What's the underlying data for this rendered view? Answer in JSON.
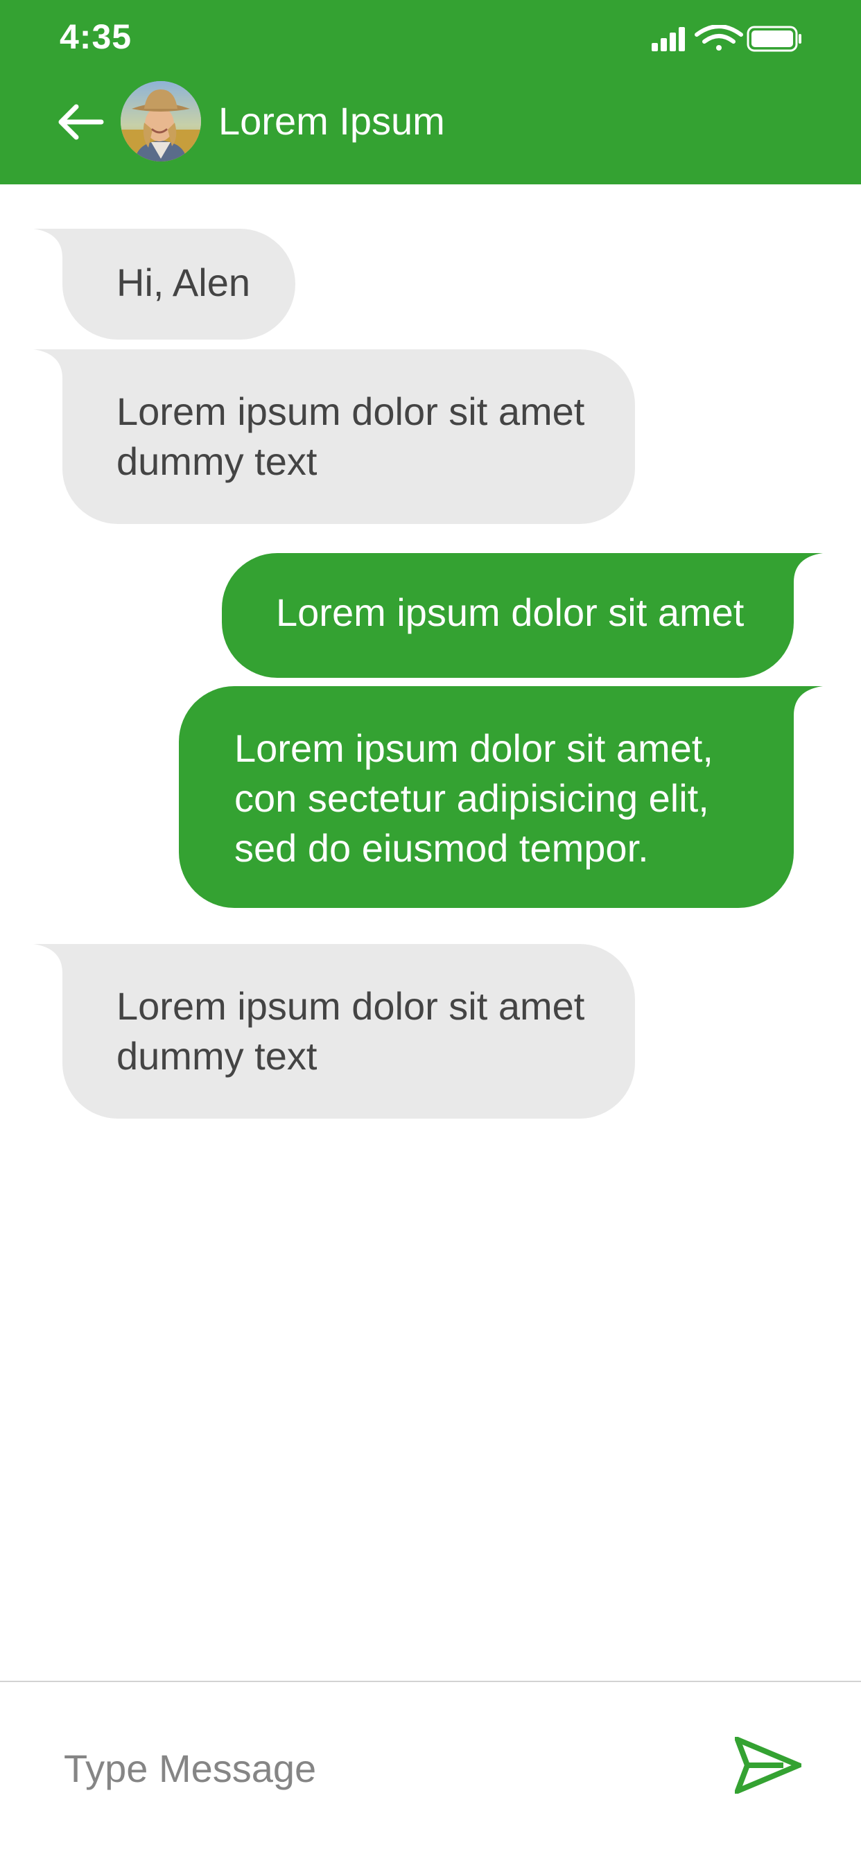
{
  "status_bar": {
    "time": "4:35"
  },
  "header": {
    "contact_name": "Lorem Ipsum"
  },
  "messages": [
    {
      "direction": "incoming",
      "text": "Hi, Alen"
    },
    {
      "direction": "incoming",
      "text": "Lorem ipsum dolor sit amet dummy text"
    },
    {
      "direction": "outgoing",
      "text": "Lorem ipsum dolor sit amet"
    },
    {
      "direction": "outgoing",
      "text": "Lorem ipsum dolor sit amet, con sectetur adipisicing elit, sed do eiusmod tempor."
    },
    {
      "direction": "incoming",
      "text": "Lorem ipsum dolor sit amet dummy text"
    }
  ],
  "composer": {
    "placeholder": "Type Message"
  },
  "icons": {
    "back": "arrow-left-icon",
    "send": "send-icon",
    "signal": "cellular-signal-icon",
    "wifi": "wifi-icon",
    "battery": "battery-icon"
  },
  "colors": {
    "brand_green": "#34a232",
    "incoming_bubble": "#e9e9e9",
    "incoming_text": "#444444",
    "outgoing_text": "#ffffff",
    "placeholder": "#858585"
  }
}
